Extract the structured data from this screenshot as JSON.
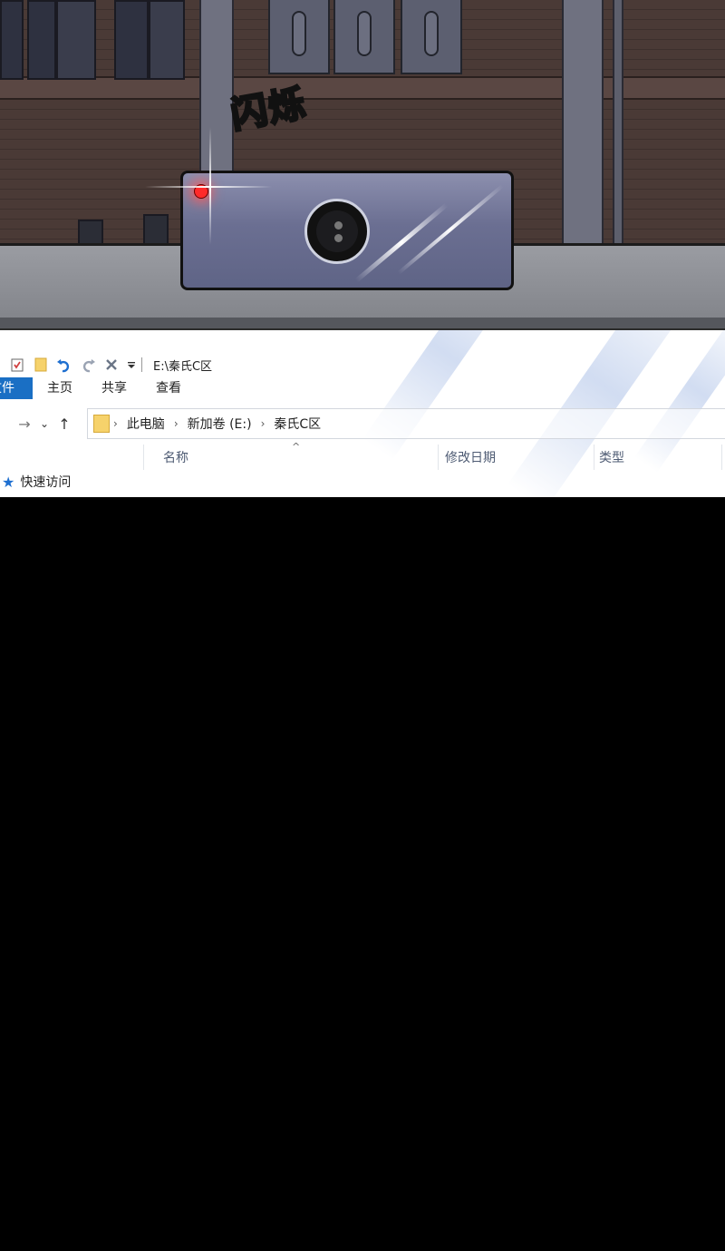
{
  "panel": {
    "sfx_text": "闪烁",
    "led_color": "#ff2a2a",
    "camera_color": "#6b6f92"
  },
  "explorer": {
    "window_title": "E:\\秦氏C区",
    "quick_access_icons": [
      "checklist-icon",
      "folder-icon",
      "undo-icon",
      "redo-icon",
      "delete-icon",
      "customize-dropdown-icon"
    ],
    "ribbon_tabs": {
      "file": "文件",
      "home": "主页",
      "share": "共享",
      "view": "查看"
    },
    "breadcrumb": [
      "此电脑",
      "新加卷 (E:)",
      "秦氏C区"
    ],
    "columns": {
      "name": "名称",
      "modified": "修改日期",
      "type": "类型"
    },
    "sidebar": {
      "quick_access": "快速访问"
    },
    "accent_color": "#1a6fc4"
  }
}
